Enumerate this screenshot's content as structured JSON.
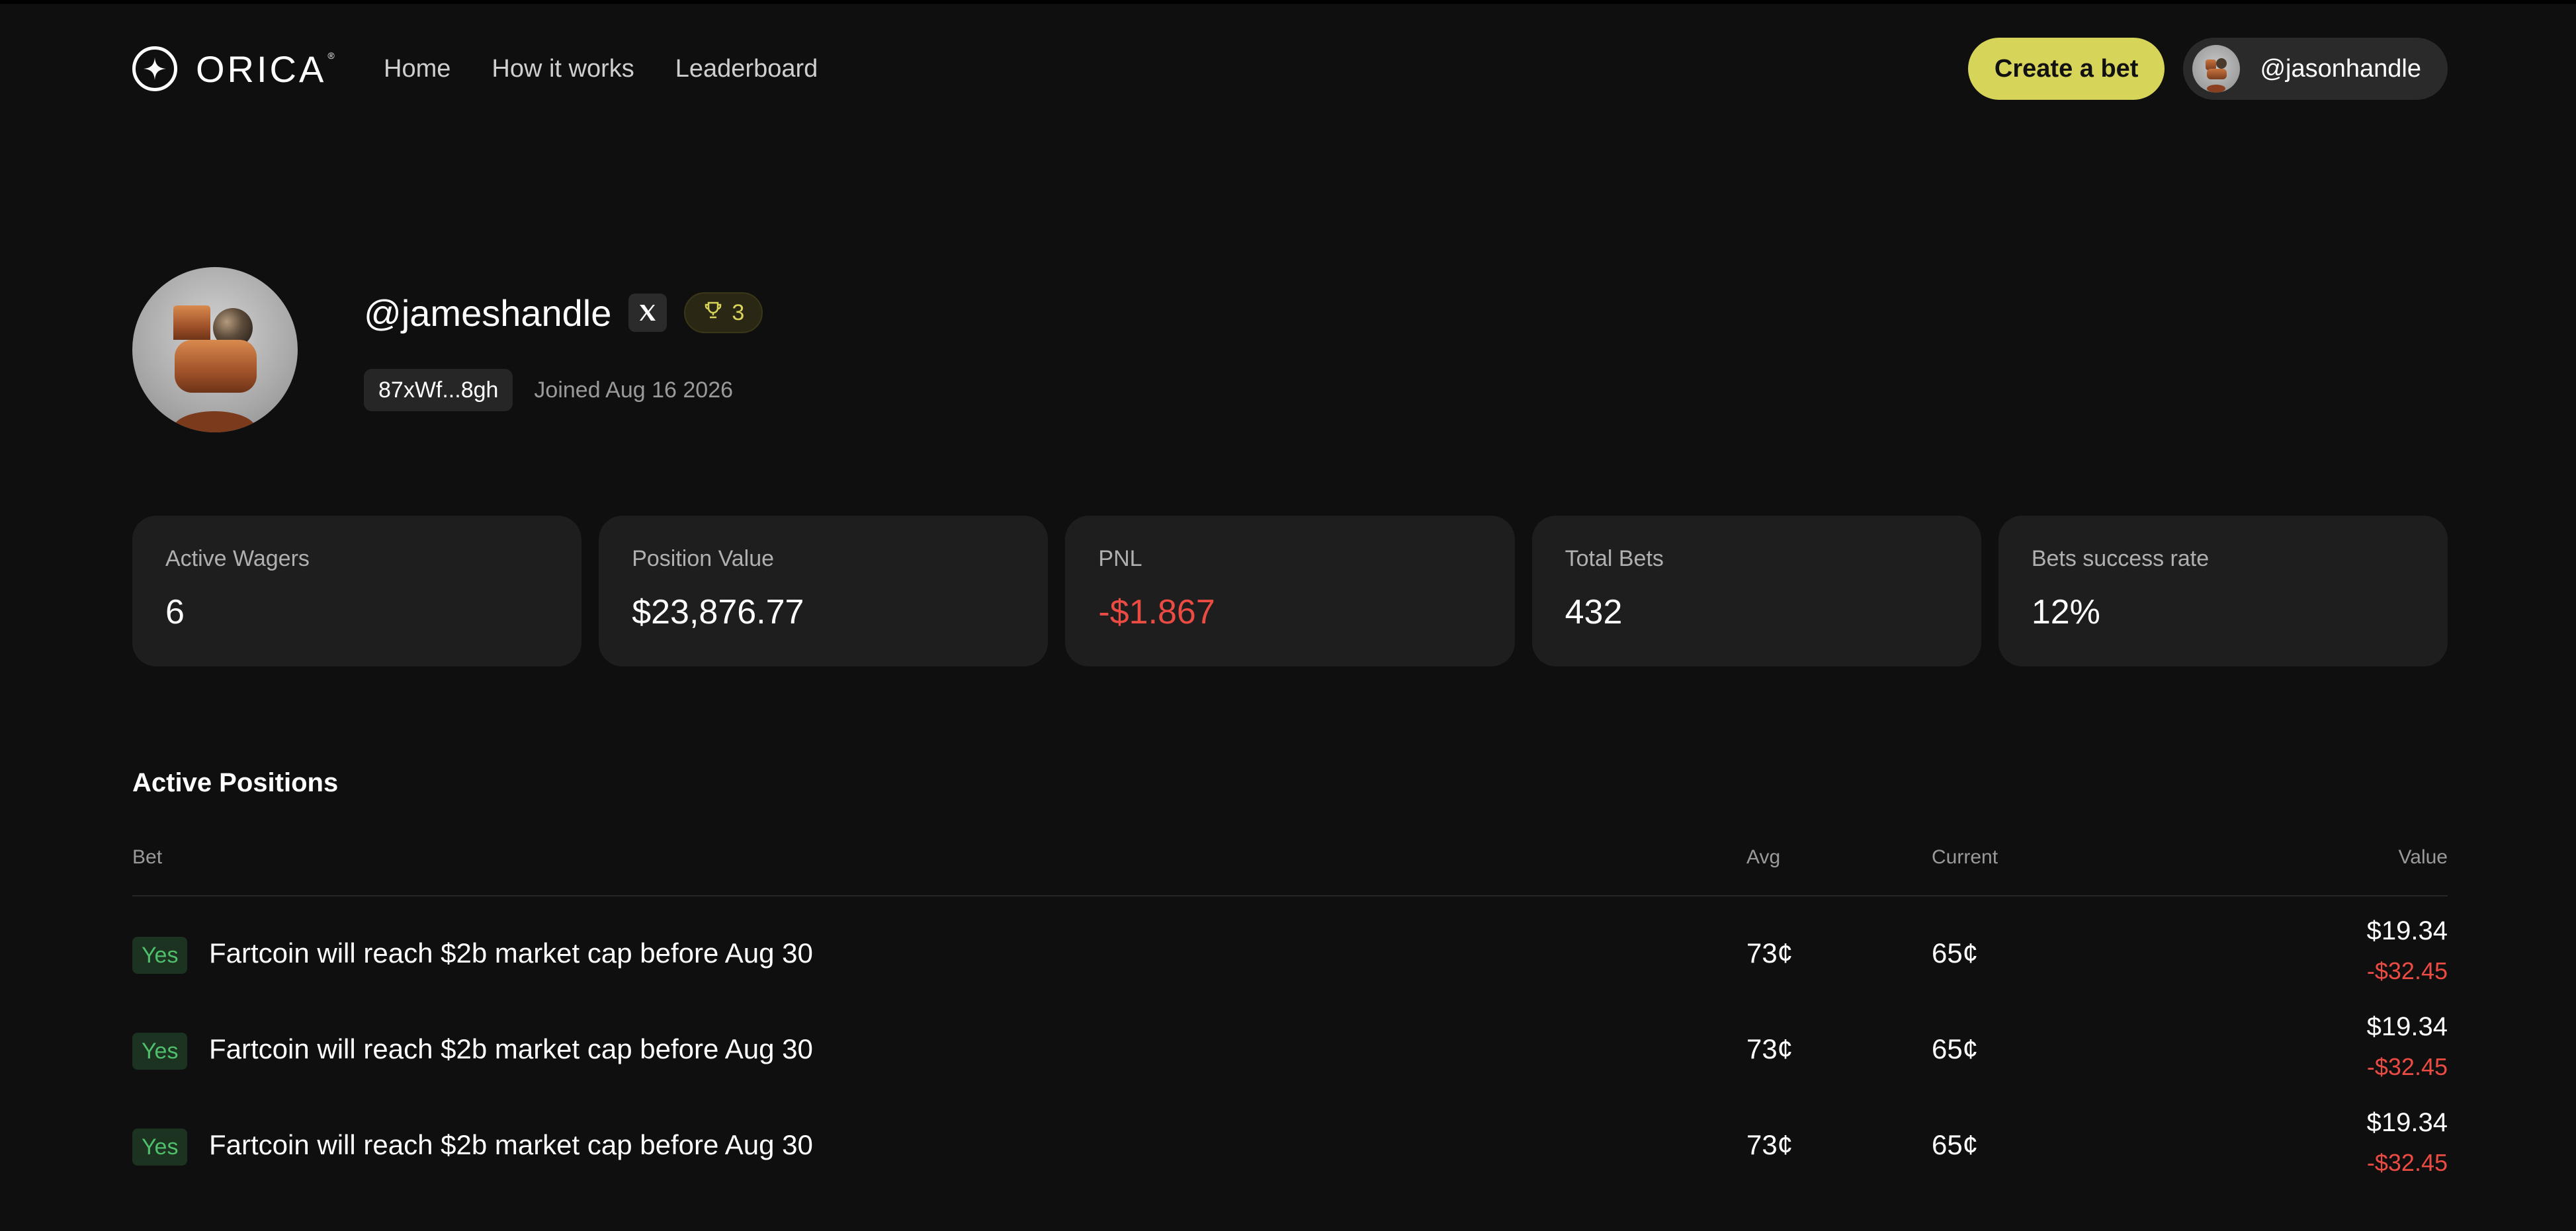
{
  "app": {
    "brand": "ORICA",
    "brand_mark": "®"
  },
  "nav": {
    "links": [
      "Home",
      "How it works",
      "Leaderboard"
    ],
    "create_label": "Create a bet",
    "user_handle": "@jasonhandle"
  },
  "profile": {
    "handle": "@jameshandle",
    "trophy_count": "3",
    "wallet": "87xWf...8gh",
    "joined": "Joined Aug 16 2026"
  },
  "stats": [
    {
      "label": "Active Wagers",
      "value": "6"
    },
    {
      "label": "Position Value",
      "value": "$23,876.77"
    },
    {
      "label": "PNL",
      "value": "-$1.867"
    },
    {
      "label": "Total Bets",
      "value": "432"
    },
    {
      "label": "Bets success rate",
      "value": "12%"
    }
  ],
  "positions": {
    "title": "Active Positions",
    "columns": {
      "bet": "Bet",
      "avg": "Avg",
      "current": "Current",
      "value": "Value"
    },
    "rows": [
      {
        "side": "Yes",
        "title": "Fartcoin will reach $2b market cap before Aug 30",
        "avg": "73¢",
        "current": "65¢",
        "value": "$19.34",
        "change": "-$32.45"
      },
      {
        "side": "Yes",
        "title": "Fartcoin will reach $2b market cap before Aug 30",
        "avg": "73¢",
        "current": "65¢",
        "value": "$19.34",
        "change": "-$32.45"
      },
      {
        "side": "Yes",
        "title": "Fartcoin will reach $2b market cap before Aug 30",
        "avg": "73¢",
        "current": "65¢",
        "value": "$19.34",
        "change": "-$32.45"
      }
    ]
  },
  "colors": {
    "accent": "#d7d45a",
    "negative": "#ea4b43",
    "positive": "#4fbf6b",
    "background": "#0f0f0f",
    "card": "#1e1e1e"
  },
  "icons": {
    "logo": "sparkle-circle-icon",
    "social": "x-logo-icon",
    "trophy": "trophy-icon"
  }
}
